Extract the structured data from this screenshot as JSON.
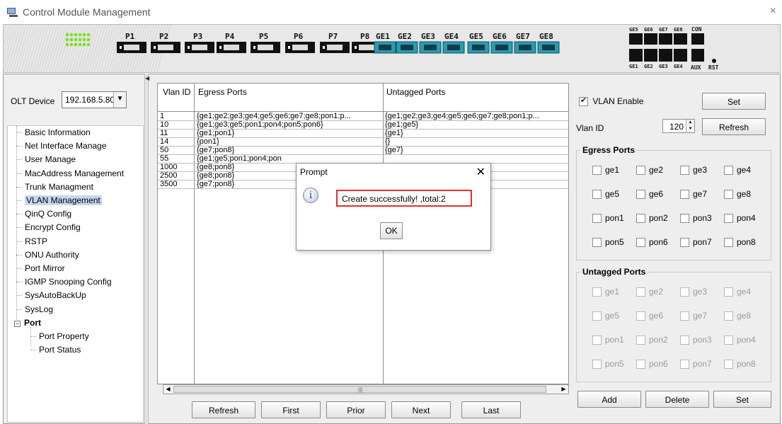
{
  "window": {
    "title": "Control Module Management",
    "close_glyph": "×"
  },
  "device_panel": {
    "pon_ports": [
      "P1",
      "P2",
      "P3",
      "P4",
      "P5",
      "P6",
      "P7",
      "P8"
    ],
    "ge_ports": [
      "GE1",
      "GE2",
      "GE3",
      "GE4",
      "GE5",
      "GE6",
      "GE7",
      "GE8"
    ],
    "ge_fiber_top": [
      "GE5",
      "GE6",
      "GE7",
      "GE8"
    ],
    "ge_fiber_bottom": [
      "GE1",
      "GE2",
      "GE3",
      "GE4"
    ],
    "con_label": "CON",
    "aux_label": "AUX",
    "rst_label": "RST",
    "port_color": "#2b9bb0"
  },
  "left": {
    "olt_label": "OLT Device",
    "olt_value": "192.168.5.80",
    "dropdown_glyph": "▼",
    "menu": [
      {
        "label": "Basic Information"
      },
      {
        "label": "Net Interface Manage"
      },
      {
        "label": "User Manage"
      },
      {
        "label": "MacAddress Management"
      },
      {
        "label": "Trunk Managment"
      },
      {
        "label": "VLAN Management",
        "selected": true
      },
      {
        "label": "QinQ Config"
      },
      {
        "label": "Encrypt Config"
      },
      {
        "label": "RSTP"
      },
      {
        "label": "ONU Authority"
      },
      {
        "label": "Port Mirror"
      },
      {
        "label": "IGMP Snooping Config"
      },
      {
        "label": "SysAutoBackUp"
      },
      {
        "label": "SysLog"
      }
    ],
    "port_group": {
      "label": "Port",
      "expander": "⊟",
      "children": [
        "Port Property",
        "Port Status"
      ]
    }
  },
  "table": {
    "headers": [
      "Vlan ID",
      "Egress Ports",
      "Untagged Ports"
    ],
    "rows": [
      [
        "1",
        "{ge1;ge2;ge3;ge4;ge5;ge6;ge7;ge8;pon1;p...",
        "{ge1;ge2;ge3;ge4;ge5;ge6;ge7;ge8;pon1;p..."
      ],
      [
        "10",
        "{ge1;ge3;ge5;pon1;pon4;pon5;pon6}",
        "{ge1;ge5}"
      ],
      [
        "11",
        "{ge1;pon1}",
        "{ge1}"
      ],
      [
        "14",
        "{pon1}",
        "{}"
      ],
      [
        "50",
        "{ge7;pon8}",
        "{ge7}"
      ],
      [
        "55",
        "{ge1;ge5;pon1;pon4;pon",
        ""
      ],
      [
        "1000",
        "{ge8;pon8}",
        ""
      ],
      [
        "2500",
        "{ge8;pon8}",
        ""
      ],
      [
        "3500",
        "{ge7;pon8}",
        ""
      ]
    ],
    "scroll_left": "◀",
    "scroll_right": "▶",
    "scroll_grip": "|||"
  },
  "pager": {
    "refresh": "Refresh",
    "first": "First",
    "prior": "Prior",
    "next": "Next",
    "last": "Last"
  },
  "right": {
    "vlan_enable_label": "VLAN Enable",
    "vlan_enable_checked": true,
    "set_label": "Set",
    "vlan_id_label": "Vlan ID",
    "vlan_id_value": "120",
    "spin_up": "▲",
    "spin_down": "▼",
    "refresh_label": "Refresh",
    "egress_title": "Egress Ports",
    "untagged_title": "Untagged Ports",
    "ports": [
      "ge1",
      "ge2",
      "ge3",
      "ge4",
      "ge5",
      "ge6",
      "ge7",
      "ge8",
      "pon1",
      "pon2",
      "pon3",
      "pon4",
      "pon5",
      "pon6",
      "pon7",
      "pon8"
    ],
    "add_label": "Add",
    "delete_label": "Delete",
    "set2_label": "Set"
  },
  "dialog": {
    "title": "Prompt",
    "close_glyph": "✕",
    "icon_glyph": "i",
    "message": "Create successfully! ,total:2",
    "ok_label": "OK"
  }
}
